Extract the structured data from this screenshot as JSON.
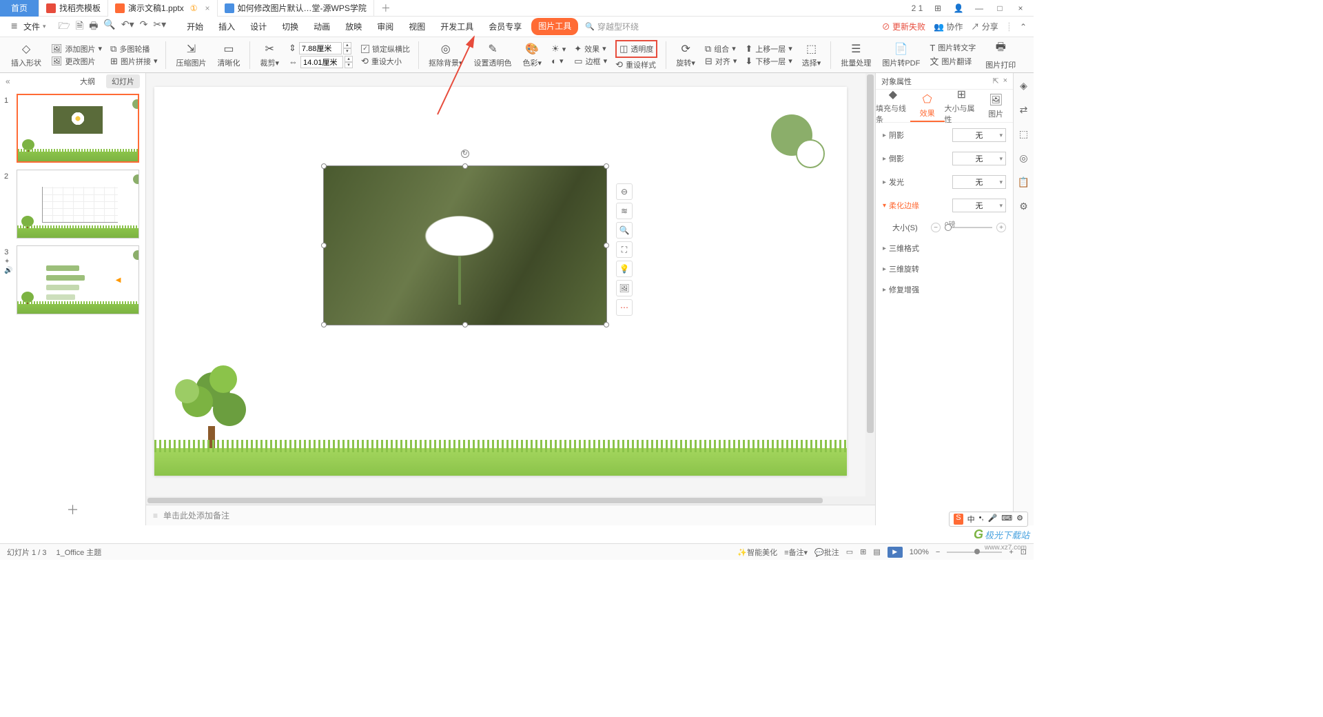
{
  "titlebar": {
    "home": "首页",
    "tabs": [
      {
        "label": "找稻壳模板"
      },
      {
        "label": "演示文稿1.pptx",
        "warn": "①"
      },
      {
        "label": "如何修改图片默认…堂-源WPS学院"
      }
    ],
    "win": {
      "count": "2 1"
    }
  },
  "menubar": {
    "file": "文件",
    "menus": [
      "开始",
      "插入",
      "设计",
      "切换",
      "动画",
      "放映",
      "审阅",
      "视图",
      "开发工具",
      "会员专享",
      "图片工具"
    ],
    "search_placeholder": "穿越型环绕",
    "right": {
      "update": "更新失败",
      "coop": "协作",
      "share": "分享"
    }
  },
  "ribbon": {
    "insert_shape": "插入形状",
    "add_pic": "添加图片",
    "multi_poll": "多图轮播",
    "change_pic": "更改图片",
    "pic_join": "图片拼接",
    "compress": "压缩图片",
    "clarify": "清晰化",
    "crop": "裁剪",
    "h": "7.88厘米",
    "w": "14.01厘米",
    "lock": "锁定纵横比",
    "reset_size": "重设大小",
    "remove_bg": "抠除背景",
    "set_trans": "设置透明色",
    "color": "色彩",
    "effect": "效果",
    "border": "边框",
    "transparency": "透明度",
    "reset_style": "重设样式",
    "rotate": "旋转",
    "combine": "组合",
    "align": "对齐",
    "up_layer": "上移一层",
    "down_layer": "下移一层",
    "select": "选择",
    "batch": "批量处理",
    "to_pdf": "图片转PDF",
    "to_text": "图片转文字",
    "translate": "图片翻译",
    "print": "图片打印"
  },
  "slidepanel": {
    "tab1": "大纲",
    "tab2": "幻灯片"
  },
  "notes": "单击此处添加备注",
  "props": {
    "title": "对象属性",
    "tabs": [
      "填充与线条",
      "效果",
      "大小与属性",
      "图片"
    ],
    "shadow": "阴影",
    "reflection": "倒影",
    "glow": "发光",
    "soft_edge": "柔化边缘",
    "none": "无",
    "size": "大小(S)",
    "size_val": "0磅",
    "three_d_format": "三维格式",
    "three_d_rotate": "三维旋转",
    "repair": "修复增强"
  },
  "status": {
    "slide": "幻灯片 1 / 3",
    "theme": "1_Office 主题",
    "beautify": "智能美化",
    "notes": "备注",
    "comment": "批注",
    "zoom": "100%"
  },
  "watermark": {
    "text": "极光下载站",
    "url": "www.xz7.com"
  },
  "ime": {
    "lang": "中"
  }
}
